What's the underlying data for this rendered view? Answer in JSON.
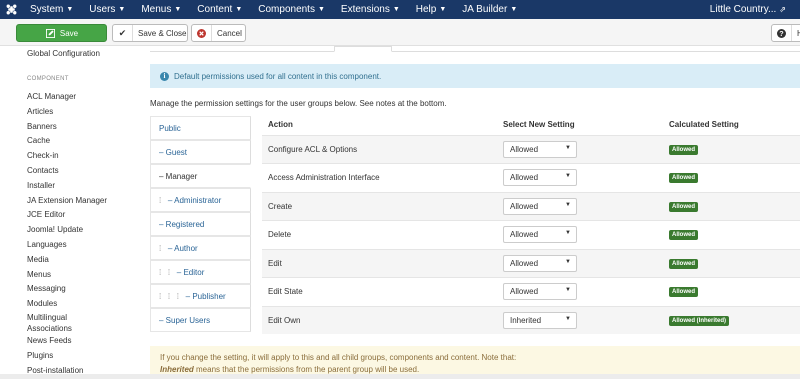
{
  "topbar": {
    "logo_icon": "joomla-logo-icon",
    "menu": [
      {
        "label": "System"
      },
      {
        "label": "Users"
      },
      {
        "label": "Menus"
      },
      {
        "label": "Content"
      },
      {
        "label": "Components"
      },
      {
        "label": "Extensions"
      },
      {
        "label": "Help"
      },
      {
        "label": "JA Builder"
      }
    ],
    "site_label": "Little Country...",
    "site_icon": "external-link-icon"
  },
  "toolbar": {
    "save_label": "Save",
    "save_close_label": "Save & Close",
    "cancel_label": "Cancel",
    "help_label": "H",
    "save_color": "#46a546",
    "cancel_icon_color": "#bd362f"
  },
  "sidebar": {
    "global_config": "Global Configuration",
    "header": "COMPONENT",
    "items": [
      "ACL Manager",
      "Articles",
      "Banners",
      "Cache",
      "Check-in",
      "Contacts",
      "Installer",
      "JA Extension Manager",
      "JCE Editor",
      "Joomla! Update",
      "Languages",
      "Media",
      "Menus",
      "Messaging",
      "Modules",
      "Multilingual Associations",
      "News Feeds",
      "Plugins",
      "Post-installation"
    ]
  },
  "info": {
    "text": "Default permissions used for all content in this component."
  },
  "manage_text": "Manage the permission settings for the user groups below. See notes at the bottom.",
  "groups": [
    {
      "prefix": "",
      "label": "Public"
    },
    {
      "prefix": "",
      "label": "– Guest"
    },
    {
      "prefix": "",
      "label": "– Manager"
    },
    {
      "prefix": "⁞   ",
      "label": "– Administrator"
    },
    {
      "prefix": "",
      "label": "– Registered"
    },
    {
      "prefix": "⁞   ",
      "label": "– Author"
    },
    {
      "prefix": "⁞   ⁞   ",
      "label": "– Editor"
    },
    {
      "prefix": "⁞   ⁞   ⁞   ",
      "label": "– Publisher"
    },
    {
      "prefix": "",
      "label": "– Super Users"
    }
  ],
  "table": {
    "headers": {
      "action": "Action",
      "select": "Select New Setting",
      "calculated": "Calculated Setting"
    },
    "rows": [
      {
        "action": "Configure ACL & Options",
        "setting": "Allowed",
        "calculated": "Allowed"
      },
      {
        "action": "Access Administration Interface",
        "setting": "Allowed",
        "calculated": "Allowed"
      },
      {
        "action": "Create",
        "setting": "Allowed",
        "calculated": "Allowed"
      },
      {
        "action": "Delete",
        "setting": "Allowed",
        "calculated": "Allowed"
      },
      {
        "action": "Edit",
        "setting": "Allowed",
        "calculated": "Allowed"
      },
      {
        "action": "Edit State",
        "setting": "Allowed",
        "calculated": "Allowed"
      },
      {
        "action": "Edit Own",
        "setting": "Inherited",
        "calculated": "Allowed (Inherited)"
      }
    ],
    "badge_color": "#3a7a2f"
  },
  "note": {
    "line1": "If you change the setting, it will apply to this and all child groups, components and content. Note that:",
    "line2_bold": "Inherited",
    "line2_rest": " means that the permissions from the parent group will be used."
  }
}
